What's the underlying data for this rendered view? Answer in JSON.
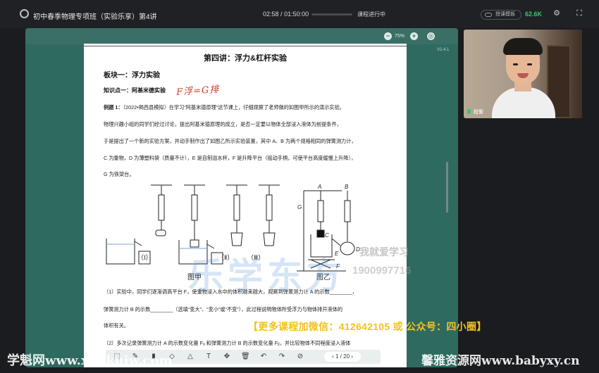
{
  "topbar": {
    "title": "初中春季物理专项班（实验乐享）第4讲",
    "time_current": "02:58",
    "time_total": "01:50:00",
    "time_sep": "/",
    "status": "课程进行中",
    "progress_fraction": 0.03,
    "mode_label": "授课模板",
    "network": "62.6K"
  },
  "board": {
    "zoom": "75%",
    "version": "V2.4.1"
  },
  "page": {
    "title": "第四讲：浮力&杠杆实验",
    "section": "板块一：浮力实验",
    "knowledge_point": "知识点一：阿基米德实验",
    "handwriting": "F浮=G排",
    "q1_label": "例题 1：",
    "q1_text": "（2022•揭西县模拟）在学习“阿基米德原理”这节课上，仔细观察了老师做的如图甲所示的演示实验。",
    "p2": "物理兴趣小组的同学们经过讨论，提出阿基米德原理的成立，是否一定要以物体全部浸入液体为前提条件，",
    "p3": "于是提出了一个新的实验方案，并动手制作出了如图乙所示实验装置，其中 A、B 为两个规格相同的弹簧测力计，",
    "p4": "C 为重物，D 为薄塑料袋（质量不计），E 是自制溢水杯，F 是升降平台（摇动手柄，可使平台高度缓慢上升降），",
    "p5": "G 为铁架台。",
    "fig_labels": {
      "i": "（Ⅰ）",
      "ii": "（Ⅱ）",
      "iii": "（Ⅲ）",
      "jia": "图甲",
      "yi": "图乙",
      "a": "A",
      "b": "B",
      "c": "C",
      "d": "D",
      "e": "E",
      "f": "F",
      "g": "G"
    },
    "s1": "（1）实验中，同学们逐渐调高平台 F，使重物浸入水中的体积越来越大，观察到弹簧测力计 A 的示数________，",
    "s2": "弹簧测力计 B 的示数________（选填“变大”、“变小”或“不变”），此过程说明物体所受浮力与物体排开液体的",
    "s3": "体积有关。",
    "s4": "（2）多次记录弹簧测力计 A 的示数变化量 Fₐ 和弹簧测力计 B 的示数变化量 Fᵦ，并比较物体不同程度浸入液体",
    "watermark_big": "乐学东方",
    "watermark_small": "我就爱学习",
    "watermark_phone": "1900997716"
  },
  "toolbar": {
    "page_current": "1",
    "page_sep": "/",
    "page_total": "20"
  },
  "camera": {
    "name": "程衡"
  },
  "overlay": {
    "promo": "【更多课程加微信：412642105 或 公众号：四小圈】",
    "watermark_left": "学魁网www.xuekuiw.com",
    "watermark_right": "馨雅资源网www.babyxy.cn"
  }
}
